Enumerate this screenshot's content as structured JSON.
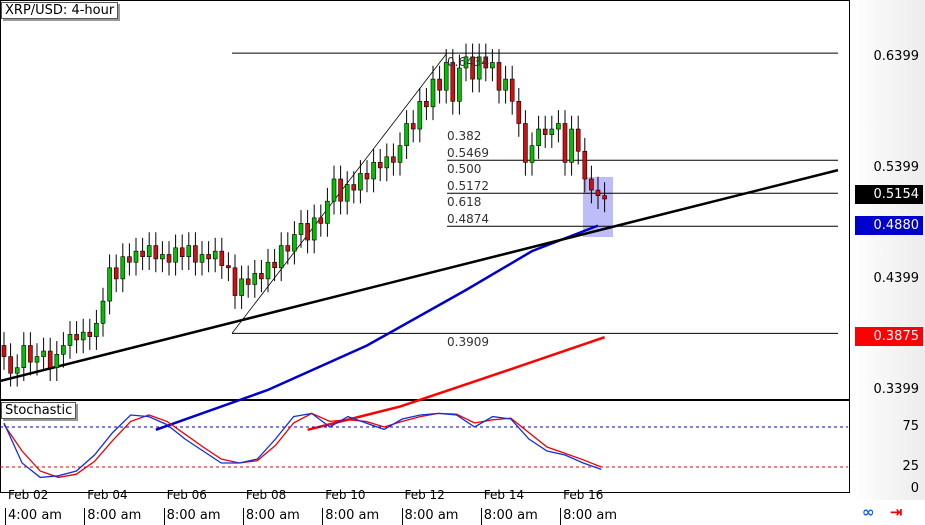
{
  "title": "XRP/USD: 4-hour",
  "indicator_title": "Stochastic",
  "chart_data": {
    "type": "candlestick",
    "symbol": "XRP/USD",
    "timeframe": "4-hour",
    "ylim": [
      0.304,
      0.67
    ],
    "y_ticks": [
      "0.6399",
      "0.5399",
      "0.4399",
      "0.3399"
    ],
    "price_tags": [
      {
        "label": "0.5154",
        "color": "#000000",
        "value": 0.5154
      },
      {
        "label": "0.4880",
        "color": "#0000cc",
        "value": 0.488
      },
      {
        "label": "0.3875",
        "color": "#ff0000",
        "value": 0.3875
      }
    ],
    "x_dates": [
      "Feb 02",
      "Feb 04",
      "Feb 06",
      "Feb 08",
      "Feb 10",
      "Feb 12",
      "Feb 14",
      "Feb 16"
    ],
    "x_times": [
      "4:00 am",
      "8:00 am",
      "8:00 am",
      "8:00 am",
      "8:00 am",
      "8:00 am",
      "8:00 am",
      "8:00 am"
    ],
    "closes": [
      0.37,
      0.355,
      0.36,
      0.38,
      0.365,
      0.37,
      0.375,
      0.36,
      0.372,
      0.38,
      0.39,
      0.385,
      0.392,
      0.388,
      0.4,
      0.42,
      0.45,
      0.44,
      0.46,
      0.455,
      0.465,
      0.46,
      0.47,
      0.458,
      0.462,
      0.455,
      0.468,
      0.46,
      0.47,
      0.455,
      0.462,
      0.458,
      0.465,
      0.452,
      0.45,
      0.425,
      0.44,
      0.435,
      0.445,
      0.44,
      0.455,
      0.45,
      0.47,
      0.465,
      0.48,
      0.49,
      0.475,
      0.495,
      0.49,
      0.51,
      0.53,
      0.51,
      0.525,
      0.52,
      0.535,
      0.53,
      0.545,
      0.54,
      0.55,
      0.545,
      0.56,
      0.58,
      0.575,
      0.6,
      0.595,
      0.62,
      0.61,
      0.635,
      0.6,
      0.63,
      0.64,
      0.62,
      0.64,
      0.63,
      0.635,
      0.61,
      0.62,
      0.6,
      0.58,
      0.545,
      0.56,
      0.575,
      0.57,
      0.575,
      0.58,
      0.545,
      0.575,
      0.555,
      0.53,
      0.52,
      0.515,
      0.512
    ],
    "fib": {
      "levels": [
        {
          "ratio": "",
          "price": "0.6434",
          "value": 0.6434
        },
        {
          "ratio": "0.382",
          "price": "0.5469",
          "value": 0.5469
        },
        {
          "ratio": "0.500",
          "price": "0.5172",
          "value": 0.5172
        },
        {
          "ratio": "0.618",
          "price": "0.4874",
          "value": 0.4874
        },
        {
          "ratio": "",
          "price": "0.3909",
          "value": 0.3909
        }
      ]
    },
    "trendline": {
      "start": 0.348,
      "end": 0.538
    },
    "ma_blue": {
      "color": "#0000cc",
      "points": [
        [
          23,
          0.304
        ],
        [
          40,
          0.34
        ],
        [
          55,
          0.38
        ],
        [
          70,
          0.43
        ],
        [
          80,
          0.465
        ],
        [
          90,
          0.488
        ]
      ]
    },
    "ma_red": {
      "color": "#ff0000",
      "points": [
        [
          46,
          0.304
        ],
        [
          60,
          0.325
        ],
        [
          75,
          0.355
        ],
        [
          91,
          0.3875
        ]
      ]
    },
    "stochastic": {
      "levels": [
        {
          "label": "75",
          "value": 75
        },
        {
          "label": "25",
          "value": 25
        },
        {
          "label": "0",
          "value": 0
        }
      ],
      "k": [
        80,
        30,
        12,
        14,
        20,
        40,
        68,
        90,
        88,
        78,
        60,
        45,
        30,
        30,
        35,
        60,
        88,
        92,
        75,
        88,
        80,
        72,
        85,
        90,
        92,
        90,
        75,
        88,
        85,
        60,
        45,
        40,
        30,
        22
      ],
      "d": [
        78,
        45,
        20,
        12,
        16,
        32,
        58,
        82,
        90,
        82,
        66,
        50,
        35,
        30,
        33,
        52,
        80,
        92,
        82,
        84,
        82,
        75,
        82,
        88,
        92,
        91,
        80,
        84,
        86,
        68,
        50,
        42,
        34,
        25
      ]
    }
  }
}
